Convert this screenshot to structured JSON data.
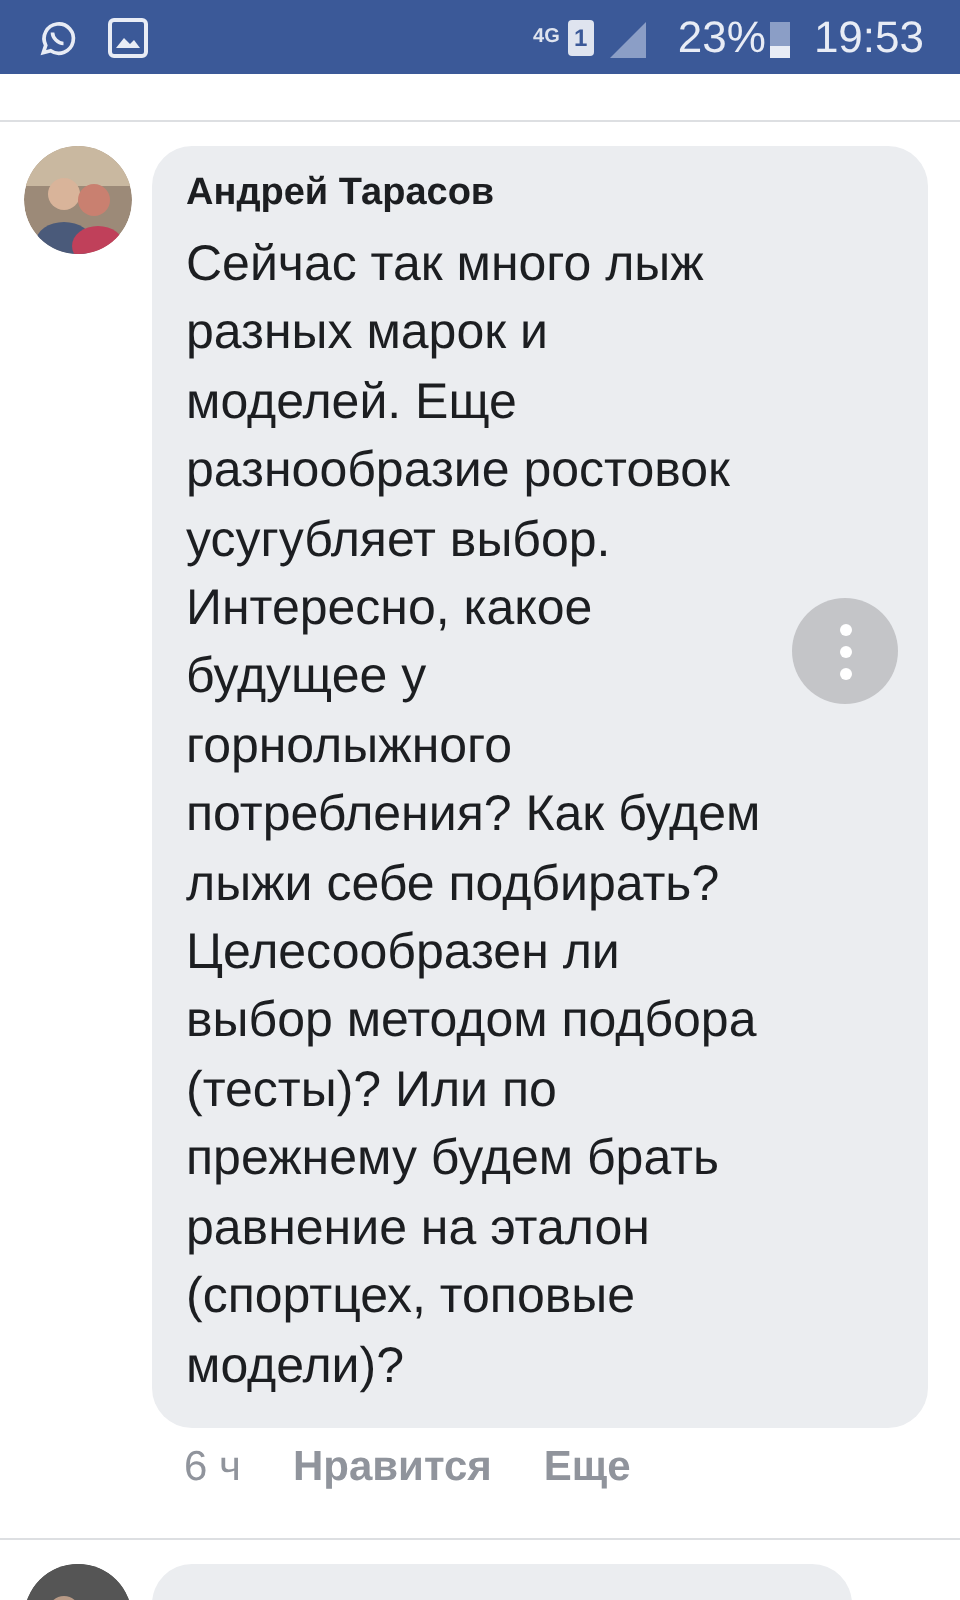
{
  "status_bar": {
    "battery": "23%",
    "time": "19:53",
    "network": "4G",
    "sim": "1"
  },
  "comment": {
    "author": "Андрей Тарасов",
    "text": "Сейчас так много лыж\nразных марок и\nмоделей. Еще\nразнообразие ростовок\nусугубляет выбор.\nИнтересно, какое\nбудущее у\nгорнолыжного\nпотребления? Как будем\nлыжи себе подбирать?\nЦелесообразен ли\nвыбор методом подбора\n(тесты)? Или по\nпрежнему будем брать\nравнение на эталон\n(спортцех, топовые\nмодели)?",
    "time": "6 ч",
    "like": "Нравится",
    "more": "Еще"
  }
}
